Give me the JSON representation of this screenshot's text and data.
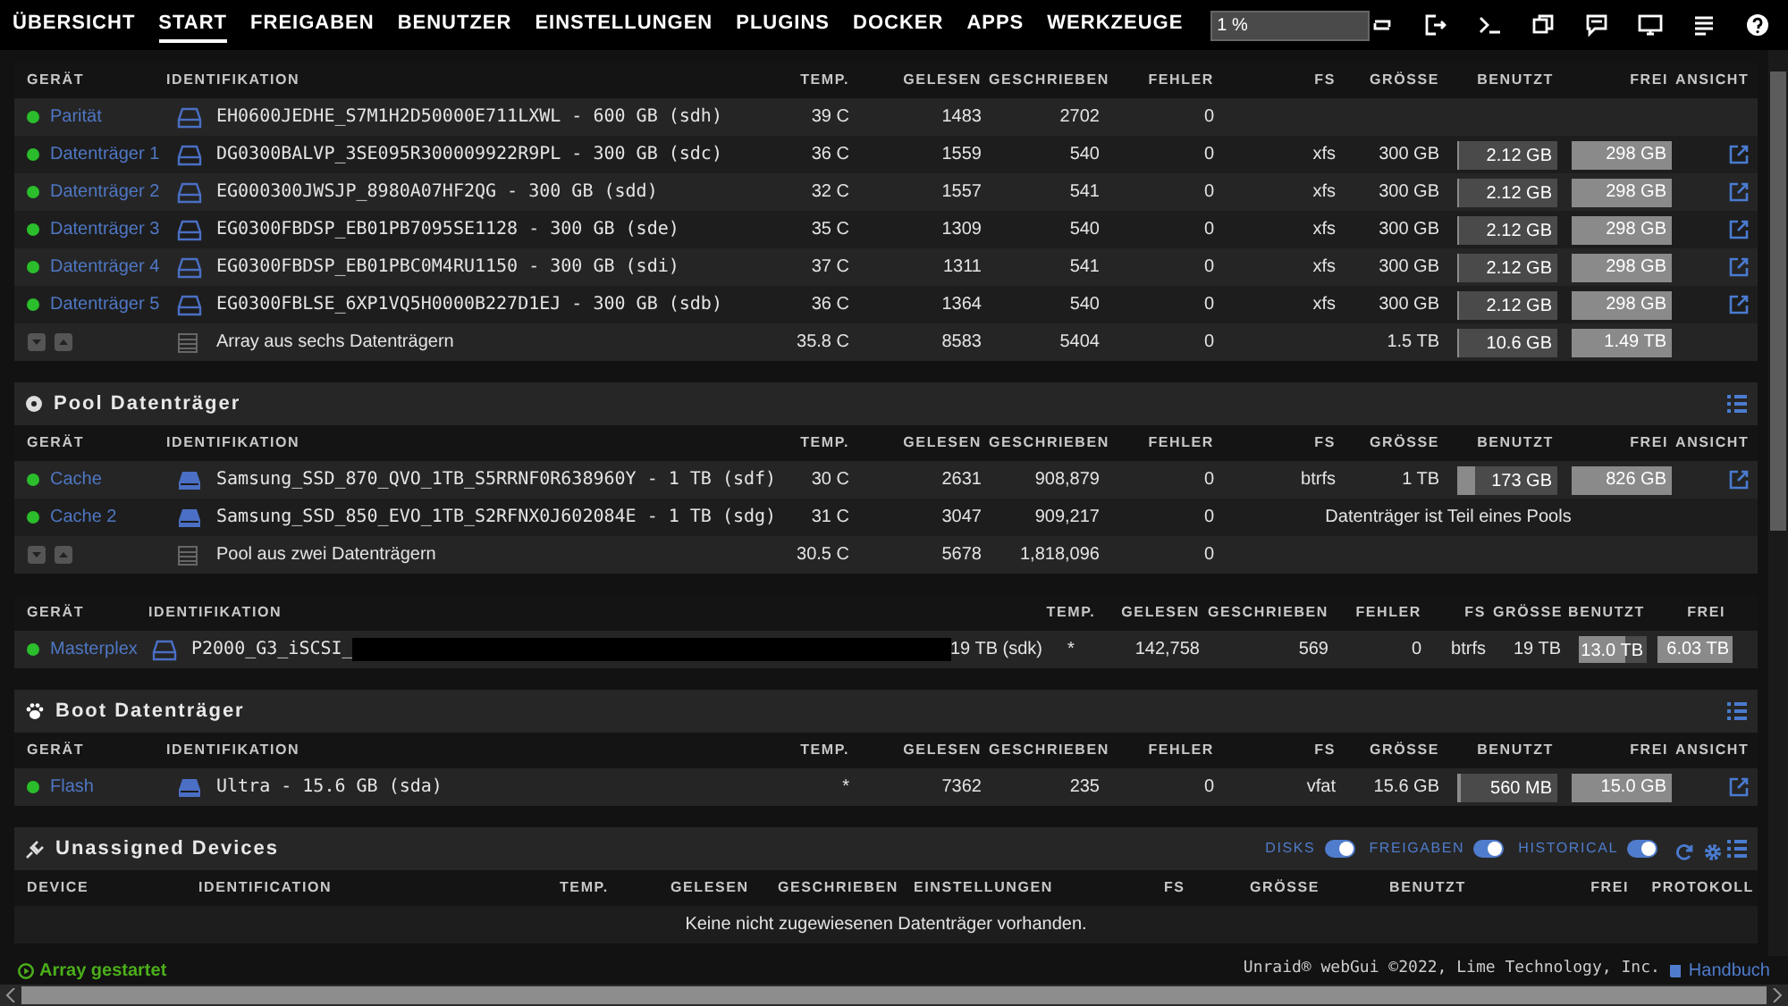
{
  "nav": {
    "items": [
      {
        "label": "ÜBERSICHT",
        "selected": false
      },
      {
        "label": "START",
        "selected": true
      },
      {
        "label": "FREIGABEN",
        "selected": false
      },
      {
        "label": "BENUTZER",
        "selected": false
      },
      {
        "label": "EINSTELLUNGEN",
        "selected": false
      },
      {
        "label": "PLUGINS",
        "selected": false
      },
      {
        "label": "DOCKER",
        "selected": false
      },
      {
        "label": "APPS",
        "selected": false
      },
      {
        "label": "WERKZEUGE",
        "selected": false
      }
    ],
    "usage_reading": "1 %"
  },
  "array": {
    "columns": [
      "GERÄT",
      "IDENTIFIKATION",
      "TEMP.",
      "GELESEN",
      "GESCHRIEBEN",
      "FEHLER",
      "FS",
      "GRÖSSE",
      "BENUTZT",
      "FREI",
      "ANSICHT"
    ],
    "rows": [
      {
        "device": "Parität",
        "ident": "EH0600JEDHE_S7M1H2D50000E711LXWL - 600 GB (sdh)",
        "temp": "39 C",
        "read": "1483",
        "write": "2702",
        "errors": "0",
        "view": false
      },
      {
        "device": "Datenträger 1",
        "ident": "DG0300BALVP_3SE095R300009922R9PL - 300 GB (sdc)",
        "temp": "36 C",
        "read": "1559",
        "write": "540",
        "errors": "0",
        "fs": "xfs",
        "size": "300 GB",
        "used": "2.12 GB",
        "level": 0.01,
        "free": "298 GB",
        "view": true
      },
      {
        "device": "Datenträger 2",
        "ident": "EG000300JWSJP_8980A07HF2QG - 300 GB (sdd)",
        "temp": "32 C",
        "read": "1557",
        "write": "541",
        "errors": "0",
        "fs": "xfs",
        "size": "300 GB",
        "used": "2.12 GB",
        "level": 0.01,
        "free": "298 GB",
        "view": true
      },
      {
        "device": "Datenträger 3",
        "ident": "EG0300FBDSP_EB01PB7095SE1128 - 300 GB (sde)",
        "temp": "35 C",
        "read": "1309",
        "write": "540",
        "errors": "0",
        "fs": "xfs",
        "size": "300 GB",
        "used": "2.12 GB",
        "level": 0.01,
        "free": "298 GB",
        "view": true
      },
      {
        "device": "Datenträger 4",
        "ident": "EG0300FBDSP_EB01PBC0M4RU1150 - 300 GB (sdi)",
        "temp": "37 C",
        "read": "1311",
        "write": "541",
        "errors": "0",
        "fs": "xfs",
        "size": "300 GB",
        "used": "2.12 GB",
        "level": 0.01,
        "free": "298 GB",
        "view": true
      },
      {
        "device": "Datenträger 5",
        "ident": "EG0300FBLSE_6XP1VQ5H0000B227D1EJ - 300 GB (sdb)",
        "temp": "36 C",
        "read": "1364",
        "write": "540",
        "errors": "0",
        "fs": "xfs",
        "size": "300 GB",
        "used": "2.12 GB",
        "level": 0.01,
        "free": "298 GB",
        "view": true
      }
    ],
    "summary": {
      "ident": "Array aus sechs Datenträgern",
      "temp": "35.8 C",
      "read": "8583",
      "write": "5404",
      "errors": "0",
      "size": "1.5 TB",
      "used": "10.6 GB",
      "level": 0.01,
      "free": "1.49 TB"
    }
  },
  "pool": {
    "title": "Pool Datenträger",
    "columns": [
      "GERÄT",
      "IDENTIFIKATION",
      "TEMP.",
      "GELESEN",
      "GESCHRIEBEN",
      "FEHLER",
      "FS",
      "GRÖSSE",
      "BENUTZT",
      "FREI",
      "ANSICHT"
    ],
    "rows": [
      {
        "device": "Cache",
        "ident": "Samsung_SSD_870_QVO_1TB_S5RRNF0R638960Y - 1 TB (sdf)",
        "temp": "30 C",
        "read": "2631",
        "write": "908,879",
        "errors": "0",
        "fs": "btrfs",
        "size": "1 TB",
        "used": "173 GB",
        "level": 0.17,
        "free": "826 GB",
        "view": true
      },
      {
        "device": "Cache 2",
        "ident": "Samsung_SSD_850_EVO_1TB_S2RFNX0J602084E - 1 TB (sdg)",
        "temp": "31 C",
        "read": "3047",
        "write": "909,217",
        "errors": "0",
        "note": "Datenträger ist Teil eines Pools",
        "view": false
      }
    ],
    "summary": {
      "ident": "Pool aus zwei Datenträgern",
      "temp": "30.5 C",
      "read": "5678",
      "write": "1,818,096",
      "errors": "0"
    }
  },
  "remote": {
    "columns": [
      "GERÄT",
      "IDENTIFIKATION",
      "TEMP.",
      "GELESEN",
      "GESCHRIEBEN",
      "FEHLER",
      "FS",
      "GRÖSSE",
      "BENUTZT",
      "FREI"
    ],
    "row": {
      "device": "Masterplex",
      "ident_start": "P2000_G3_iSCSI_",
      "ident_end": "19 TB (sdk)",
      "temp": "*",
      "read": "142,758",
      "write": "569",
      "errors": "0",
      "fs": "btrfs",
      "size": "19 TB",
      "used": "13.0 TB",
      "level": 0.68,
      "free": "6.03 TB"
    }
  },
  "boot": {
    "title": "Boot Datenträger",
    "columns": [
      "GERÄT",
      "IDENTIFIKATION",
      "TEMP.",
      "GELESEN",
      "GESCHRIEBEN",
      "FEHLER",
      "FS",
      "GRÖSSE",
      "BENUTZT",
      "FREI",
      "ANSICHT"
    ],
    "rows": [
      {
        "device": "Flash",
        "ident": "Ultra - 15.6 GB (sda)",
        "temp": "*",
        "read": "7362",
        "write": "235",
        "errors": "0",
        "fs": "vfat",
        "size": "15.6 GB",
        "used": "560 MB",
        "level": 0.04,
        "free": "15.0 GB",
        "view": true
      }
    ]
  },
  "unassigned": {
    "title": "Unassigned Devices",
    "toggles": [
      {
        "label": "DISKS",
        "on": true
      },
      {
        "label": "FREIGABEN",
        "on": true
      },
      {
        "label": "HISTORICAL",
        "on": true
      }
    ],
    "columns": [
      "DEVICE",
      "IDENTIFICATION",
      "TEMP.",
      "GELESEN",
      "GESCHRIEBEN",
      "EINSTELLUNGEN",
      "FS",
      "GRÖSSE",
      "BENUTZT",
      "FREI",
      "PROTOKOLL"
    ],
    "message": "Keine nicht zugewiesenen Datenträger vorhanden."
  },
  "status_bar": {
    "array_state": "Array gestartet",
    "copyright": "Unraid® webGui ©2022, Lime Technology, Inc.",
    "manual_link": "Handbuch"
  }
}
